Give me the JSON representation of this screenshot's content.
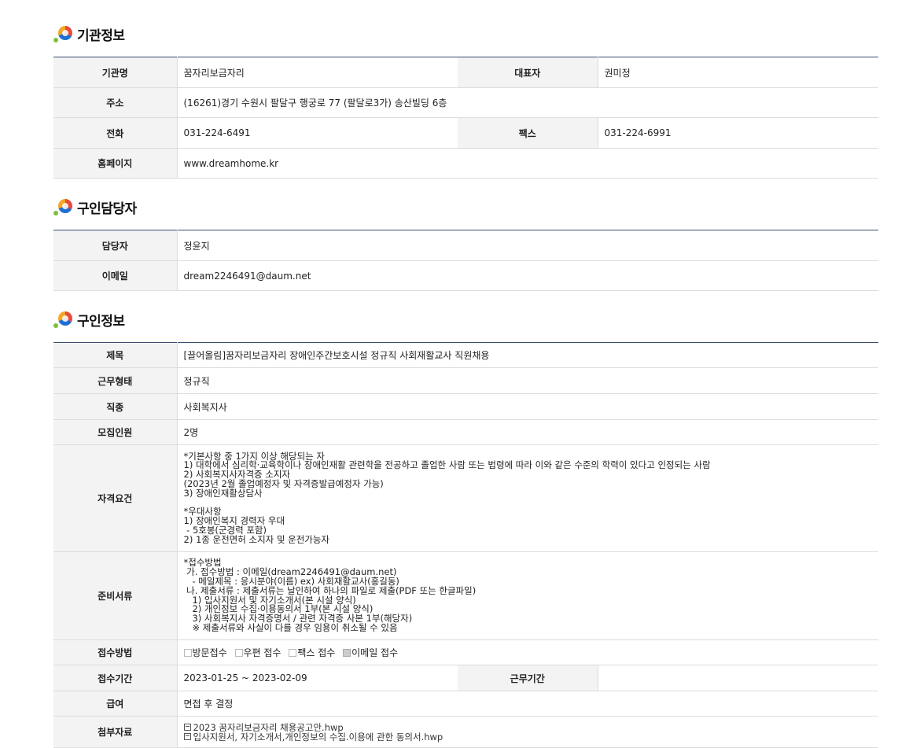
{
  "sections": {
    "org": {
      "title": "기관정보",
      "rows": {
        "name_label": "기관명",
        "name": "꿈자리보금자리",
        "rep_label": "대표자",
        "rep": "권미정",
        "addr_label": "주소",
        "addr": "(16261)경기 수원시 팔달구 행궁로 77 (팔달로3가) 송산빌딩 6층",
        "phone_label": "전화",
        "phone": "031-224-6491",
        "fax_label": "팩스",
        "fax": "031-224-6991",
        "home_label": "홈페이지",
        "home": "www.dreamhome.kr"
      }
    },
    "contact": {
      "title": "구인담당자",
      "rows": {
        "person_label": "담당자",
        "person": "정윤지",
        "email_label": "이메일",
        "email": "dream2246491@daum.net"
      }
    },
    "job": {
      "title": "구인정보",
      "rows": {
        "subject_label": "제목",
        "subject": "[끌어올림]꿈자리보금자리 장애인주간보호시설 정규직 사회재활교사 직원채용",
        "type_label": "근무형태",
        "type": "정규직",
        "category_label": "직종",
        "category": "사회복지사",
        "count_label": "모집인원",
        "count": "2명",
        "qual_label": "자격요건",
        "qual": "*기본사항 중 1가지 이상 해당되는 자\n1) 대학에서 심리학·교육학이나 장애인재활 관련학을 전공하고 졸업한 사람 또는 법령에 따라 이와 같은 수준의 학력이 있다고 인정되는 사람\n2) 사회복지사자격증 소지자\n(2023년 2월 졸업예정자 및 자격증발급예정자 가능)\n3) 장애인재활상담사\n\n*우대사항\n1) 장애인복지 경력자 우대\n - 5호봉(군경력 포함)\n2) 1종 운전면허 소지자 및 운전가능자",
        "docs_label": "준비서류",
        "docs": "*접수방법\n 가. 접수방법 : 이메일(dream2246491@daum.net)\n   - 메일제목 : 응시분야(이름) ex) 사회재활교사(홍길동)\n 나. 제출서류 : 제출서류는 날인하여 하나의 파일로 제출(PDF 또는 한글파일)\n   1) 입사지원서 및 자기소개서(본 시설 양식)\n   2) 개인정보 수집·이용동의서 1부(본 시설 양식)\n   3) 사회복지사 자격증명서 / 관련 자격증 사본 1부(해당자)\n   ※ 제출서류와 사실이 다를 경우 임용이 취소될 수 있음",
        "method_label": "접수방법",
        "methods": [
          "방문접수",
          "우편 접수",
          "팩스 접수",
          "이메일 접수"
        ],
        "methods_checked": [
          false,
          false,
          false,
          true
        ],
        "period_label": "접수기간",
        "period": "2023-01-25 ~ 2023-02-09",
        "work_period_label": "근무기간",
        "work_period": "",
        "salary_label": "급여",
        "salary": "면접 후 결정",
        "files_label": "첨부자료",
        "files": [
          "2023 꿈자리보금자리 채용공고안.hwp",
          "입사지원서, 자기소개서,개인정보의 수집.이용에 관한 동의서.hwp"
        ]
      }
    }
  }
}
